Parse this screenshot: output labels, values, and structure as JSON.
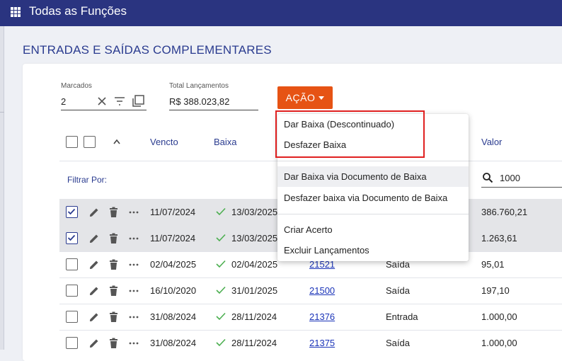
{
  "topbar": {
    "title": "Todas as Funções",
    "icon": "apps-grid-icon"
  },
  "page": {
    "title": "ENTRADAS E SAÍDAS COMPLEMENTARES"
  },
  "toolbar": {
    "marcados_label": "Marcados",
    "marcados_value": "2",
    "total_label": "Total Lançamentos",
    "total_value": "R$ 388.023,82",
    "acao_label": "AÇÃO"
  },
  "table": {
    "headers": {
      "vencto": "Vencto",
      "baixa": "Baixa",
      "valor": "Valor"
    },
    "filter_label": "Filtrar Por:",
    "search_value": "1000",
    "rows": [
      {
        "checked": true,
        "vencto": "11/07/2024",
        "baixa": "13/03/2025",
        "doc": "",
        "tipo": "",
        "valor": "386.760,21"
      },
      {
        "checked": true,
        "vencto": "11/07/2024",
        "baixa": "13/03/2025",
        "doc": "",
        "tipo": "",
        "valor": "1.263,61"
      },
      {
        "checked": false,
        "vencto": "02/04/2025",
        "baixa": "02/04/2025",
        "doc": "21521",
        "tipo": "Saída",
        "valor": "95,01"
      },
      {
        "checked": false,
        "vencto": "16/10/2020",
        "baixa": "31/01/2025",
        "doc": "21500",
        "tipo": "Saída",
        "valor": "197,10"
      },
      {
        "checked": false,
        "vencto": "31/08/2024",
        "baixa": "28/11/2024",
        "doc": "21376",
        "tipo": "Entrada",
        "valor": "1.000,00"
      },
      {
        "checked": false,
        "vencto": "31/08/2024",
        "baixa": "28/11/2024",
        "doc": "21375",
        "tipo": "Saída",
        "valor": "1.000,00"
      }
    ]
  },
  "menu": {
    "items": [
      "Dar Baixa (Descontinuado)",
      "Desfazer Baixa",
      "Dar Baixa via Documento de Baixa",
      "Desfazer baixa via Documento de Baixa",
      "Criar Acerto",
      "Excluir Lançamentos"
    ]
  },
  "colors": {
    "topbar": "#2a3480",
    "accent": "#e65314",
    "link": "#1a33b8",
    "highlight": "#e02020"
  }
}
